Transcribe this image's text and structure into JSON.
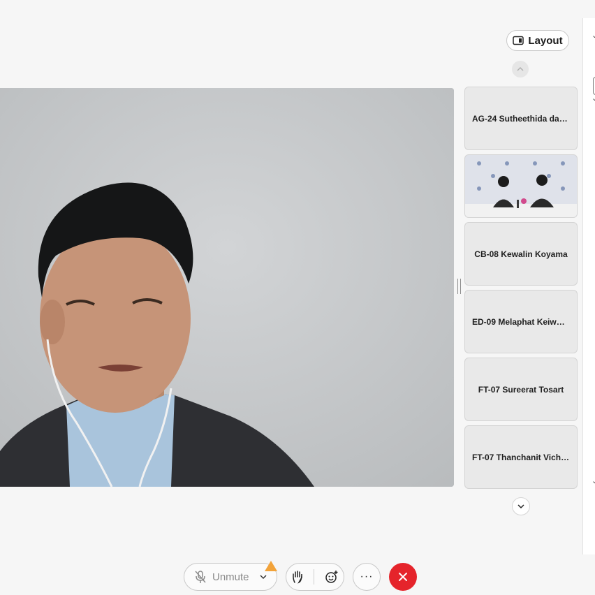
{
  "header": {
    "layout_label": "Layout"
  },
  "participants": [
    {
      "name": "AG-24 Sutheethida dam...",
      "video": false
    },
    {
      "name": "",
      "video": true
    },
    {
      "name": "CB-08 Kewalin Koyama",
      "video": false
    },
    {
      "name": "ED-09 Melaphat Keiwde...",
      "video": false
    },
    {
      "name": "FT-07 Sureerat Tosart",
      "video": false
    },
    {
      "name": "FT-07 Thanchanit Vichu...",
      "video": false
    }
  ],
  "toolbar": {
    "unmute_label": "Unmute",
    "more_label": "···"
  },
  "icons": {
    "layout": "layout-icon",
    "scroll_up": "chevron-up-icon",
    "scroll_down": "chevron-down-icon",
    "mic": "mic-muted-icon",
    "warning": "warning-icon",
    "hand": "raise-hand-icon",
    "reaction": "emoji-reaction-icon",
    "end": "close-icon"
  },
  "colors": {
    "end_call": "#e5242b",
    "warning": "#f2a33a"
  }
}
